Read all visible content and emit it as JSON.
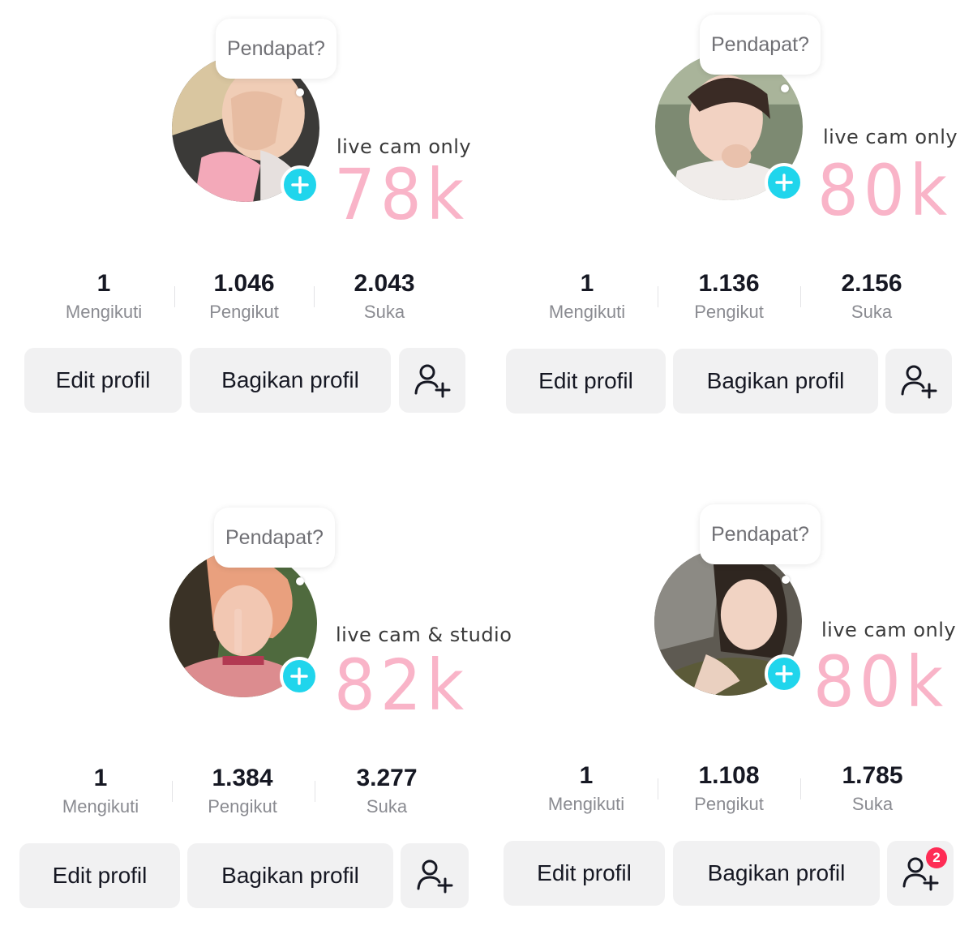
{
  "colors": {
    "accent_cyan": "#20d5ec",
    "highlight_pink": "#f9b4c8",
    "button_bg": "#f1f1f2",
    "notification_red": "#fe2c55"
  },
  "panels": [
    {
      "bubble": "Pendapat?",
      "tagline": "live cam only",
      "bignum": "78k",
      "stats": [
        {
          "value": "1",
          "label": "Mengikuti"
        },
        {
          "value": "1.046",
          "label": "Pengikut"
        },
        {
          "value": "2.043",
          "label": "Suka"
        }
      ],
      "buttons": {
        "edit": "Edit profil",
        "share": "Bagikan profil"
      },
      "icons": {
        "add": "plus-icon",
        "friend": "add-friend-icon"
      }
    },
    {
      "bubble": "Pendapat?",
      "tagline": "live cam only",
      "bignum": "80k",
      "stats": [
        {
          "value": "1",
          "label": "Mengikuti"
        },
        {
          "value": "1.136",
          "label": "Pengikut"
        },
        {
          "value": "2.156",
          "label": "Suka"
        }
      ],
      "buttons": {
        "edit": "Edit profil",
        "share": "Bagikan profil"
      },
      "icons": {
        "add": "plus-icon",
        "friend": "add-friend-icon"
      }
    },
    {
      "bubble": "Pendapat?",
      "tagline": "live cam & studio",
      "bignum": "82k",
      "stats": [
        {
          "value": "1",
          "label": "Mengikuti"
        },
        {
          "value": "1.384",
          "label": "Pengikut"
        },
        {
          "value": "3.277",
          "label": "Suka"
        }
      ],
      "buttons": {
        "edit": "Edit profil",
        "share": "Bagikan profil"
      },
      "icons": {
        "add": "plus-icon",
        "friend": "add-friend-icon"
      }
    },
    {
      "bubble": "Pendapat?",
      "tagline": "live cam only",
      "bignum": "80k",
      "stats": [
        {
          "value": "1",
          "label": "Mengikuti"
        },
        {
          "value": "1.108",
          "label": "Pengikut"
        },
        {
          "value": "1.785",
          "label": "Suka"
        }
      ],
      "buttons": {
        "edit": "Edit profil",
        "share": "Bagikan profil"
      },
      "friend_badge": "2",
      "icons": {
        "add": "plus-icon",
        "friend": "add-friend-icon"
      }
    }
  ]
}
